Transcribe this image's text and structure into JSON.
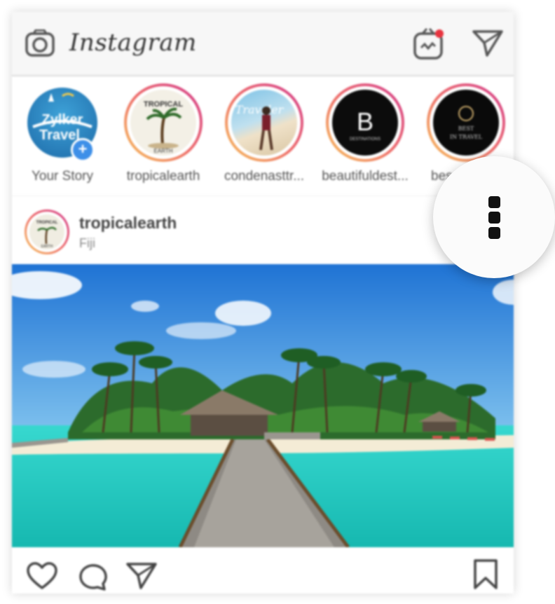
{
  "app": {
    "title": "Instagram"
  },
  "header": {
    "icons": [
      "camera-icon",
      "igtv-icon",
      "direct-message-icon"
    ],
    "igtv_notification_color": "#e8333e"
  },
  "stories": [
    {
      "name": "Your Story",
      "avatar_text": "Zylker Travel",
      "own": true
    },
    {
      "name": "tropicalearth",
      "avatar_text": "TROPICAL EARTH"
    },
    {
      "name": "condenasttr...",
      "avatar_text": "Traveler"
    },
    {
      "name": "beautifuldest...",
      "avatar_text": "B"
    },
    {
      "name": "bes",
      "avatar_text": "BEST IN TRAVEL"
    }
  ],
  "post": {
    "username": "tropicalearth",
    "location": "Fiji",
    "avatar_text": "TROPICAL EARTH"
  },
  "actions": {
    "icons": [
      "heart-icon",
      "comment-icon",
      "share-icon",
      "bookmark-icon"
    ]
  },
  "overlay": {
    "icon": "more-vertical-icon"
  },
  "colors": {
    "story_ring_start": "#f6c15a",
    "story_ring_end": "#d23a8a",
    "add_badge": "#3d8fe8",
    "sky": "#3a8fe0",
    "lagoon": "#2dd3c8"
  }
}
